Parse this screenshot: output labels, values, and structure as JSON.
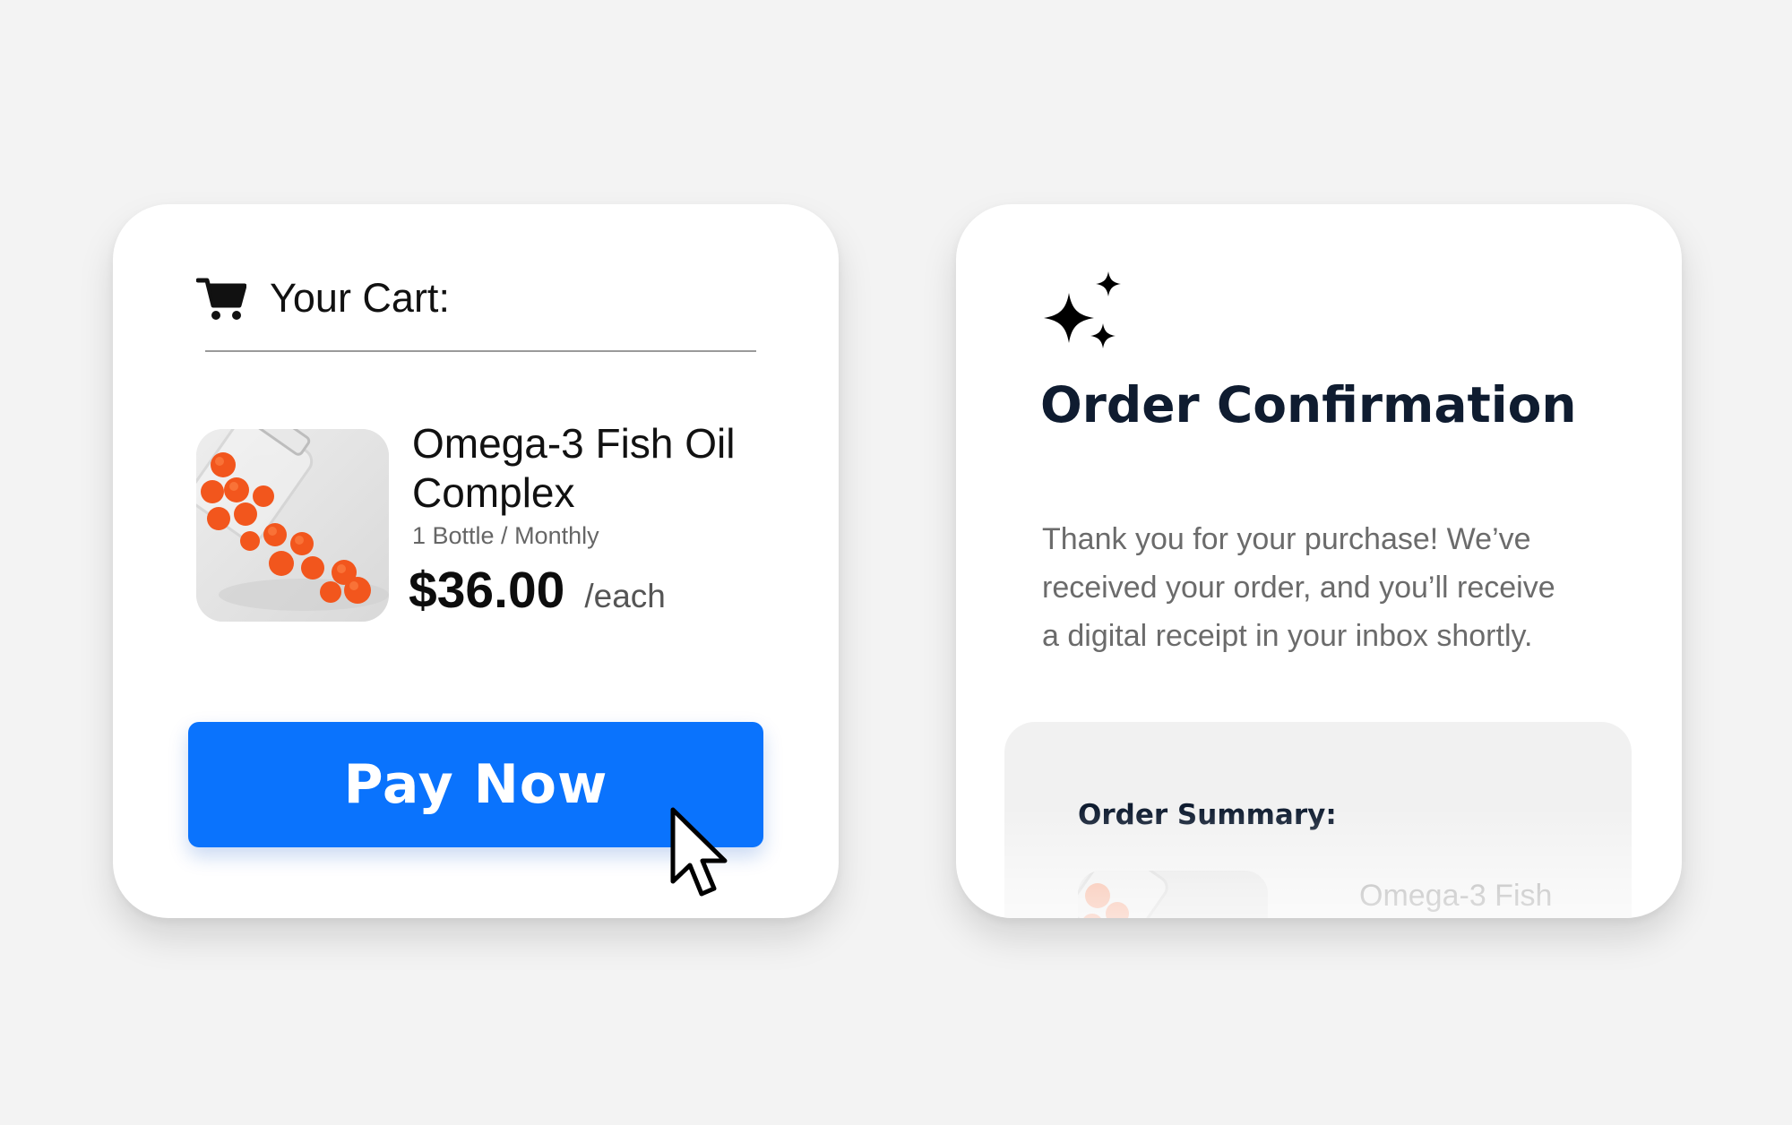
{
  "cart": {
    "title": "Your Cart:",
    "icon": "shopping-cart-icon",
    "item": {
      "name": "Omega-3 Fish Oil Complex",
      "variant": "1 Bottle / Monthly",
      "price": "$36.00",
      "price_unit": "/each",
      "image": "orange-gummies-spilling-from-jar"
    },
    "pay_button": {
      "label": "Pay Now",
      "color": "#0a73fd"
    }
  },
  "confirmation": {
    "icon": "sparkle-icon",
    "title": "Order Confirmation",
    "message": "Thank you for your purchase! We’ve received your order, and you’ll receive a digital receipt in your inbox shortly.",
    "summary": {
      "title": "Order Summary:",
      "item_name": "Omega-3 Fish"
    }
  },
  "colors": {
    "background": "#f3f3f3",
    "card": "#ffffff",
    "accent": "#0a73fd",
    "title_navy": "#0f1c30"
  }
}
